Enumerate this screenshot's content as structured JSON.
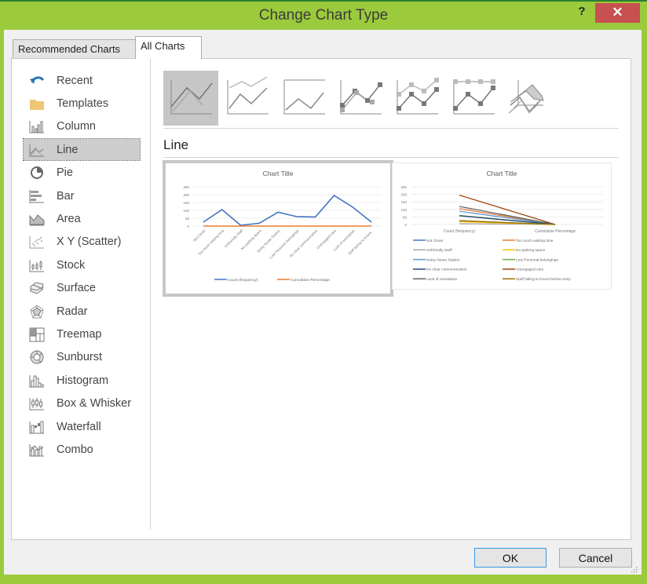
{
  "window": {
    "title": "Change Chart Type",
    "help_label": "?",
    "close_label": "✕"
  },
  "tabs": [
    {
      "label": "Recommended Charts",
      "active": false
    },
    {
      "label": "All Charts",
      "active": true
    }
  ],
  "sidebar": {
    "items": [
      {
        "label": "Recent",
        "icon": "recent-icon",
        "selected": false
      },
      {
        "label": "Templates",
        "icon": "folder-icon",
        "selected": false
      },
      {
        "label": "Column",
        "icon": "column-chart-icon",
        "selected": false
      },
      {
        "label": "Line",
        "icon": "line-chart-icon",
        "selected": true
      },
      {
        "label": "Pie",
        "icon": "pie-chart-icon",
        "selected": false
      },
      {
        "label": "Bar",
        "icon": "bar-chart-icon",
        "selected": false
      },
      {
        "label": "Area",
        "icon": "area-chart-icon",
        "selected": false
      },
      {
        "label": "X Y (Scatter)",
        "icon": "scatter-chart-icon",
        "selected": false
      },
      {
        "label": "Stock",
        "icon": "stock-chart-icon",
        "selected": false
      },
      {
        "label": "Surface",
        "icon": "surface-chart-icon",
        "selected": false
      },
      {
        "label": "Radar",
        "icon": "radar-chart-icon",
        "selected": false
      },
      {
        "label": "Treemap",
        "icon": "treemap-chart-icon",
        "selected": false
      },
      {
        "label": "Sunburst",
        "icon": "sunburst-chart-icon",
        "selected": false
      },
      {
        "label": "Histogram",
        "icon": "histogram-chart-icon",
        "selected": false
      },
      {
        "label": "Box & Whisker",
        "icon": "box-whisker-chart-icon",
        "selected": false
      },
      {
        "label": "Waterfall",
        "icon": "waterfall-chart-icon",
        "selected": false
      },
      {
        "label": "Combo",
        "icon": "combo-chart-icon",
        "selected": false
      }
    ]
  },
  "subtypes": [
    {
      "name": "line",
      "selected": true
    },
    {
      "name": "stacked-line",
      "selected": false
    },
    {
      "name": "100-stacked-line",
      "selected": false
    },
    {
      "name": "line-with-markers",
      "selected": false
    },
    {
      "name": "stacked-line-with-markers",
      "selected": false
    },
    {
      "name": "100-stacked-line-with-markers",
      "selected": false
    },
    {
      "name": "3d-line",
      "selected": false
    }
  ],
  "section_title": "Line",
  "colors": {
    "window_frame": "#9bca3c",
    "close_button": "#c75050",
    "ok_border": "#3c97e0",
    "selection": "#cdcdcd"
  },
  "chart_data": [
    {
      "type": "line",
      "title": "Chart Title",
      "categories": [
        "Not Clean",
        "Too much waiting time",
        "Unfriendly Staff",
        "No parking space",
        "Noisy Nurse Station",
        "Lost Personal belongings",
        "No clear communication",
        "Unengaged care",
        "Lack of orientation",
        "Staff failing to knock..."
      ],
      "series": [
        {
          "name": "Count (frequency)",
          "color": "#4472c4",
          "values": [
            25,
            105,
            5,
            18,
            88,
            60,
            58,
            195,
            120,
            25
          ]
        },
        {
          "name": "Cumulative Percentage",
          "color": "#ed7d31",
          "values": [
            0,
            0,
            0,
            0,
            0,
            0,
            0,
            0,
            0,
            0
          ]
        }
      ],
      "yticks": [
        "0",
        "50",
        "100",
        "150",
        "200",
        "250"
      ],
      "ylim": [
        0,
        250
      ],
      "grid": true,
      "legend": "bottom",
      "selected": true
    },
    {
      "type": "line",
      "title": "Chart Title",
      "categories": [
        "Count (frequency)",
        "Cumulative Percentage"
      ],
      "series": [
        {
          "name": "Not Clean",
          "color": "#4472c4",
          "values": [
            25,
            0
          ]
        },
        {
          "name": "Too much waiting time",
          "color": "#ed7d31",
          "values": [
            105,
            0
          ]
        },
        {
          "name": "Unfriendly Staff",
          "color": "#a5a5a5",
          "values": [
            5,
            0
          ]
        },
        {
          "name": "No parking space",
          "color": "#ffc000",
          "values": [
            18,
            0
          ]
        },
        {
          "name": "Noisy Nurse Station",
          "color": "#5b9bd5",
          "values": [
            88,
            0
          ]
        },
        {
          "name": "Lost Personal belongings",
          "color": "#70ad47",
          "values": [
            60,
            0
          ]
        },
        {
          "name": "No clear communication",
          "color": "#264478",
          "values": [
            58,
            0
          ]
        },
        {
          "name": "Unengaged care",
          "color": "#9e480e",
          "values": [
            195,
            0
          ]
        },
        {
          "name": "Lack of orientation",
          "color": "#636363",
          "values": [
            120,
            0
          ]
        },
        {
          "name": "Staff failing to knock before entry",
          "color": "#997300",
          "values": [
            25,
            0
          ]
        }
      ],
      "yticks": [
        "0",
        "50",
        "100",
        "150",
        "200",
        "250"
      ],
      "ylim": [
        0,
        250
      ],
      "grid": true,
      "legend": "bottom",
      "selected": false
    }
  ],
  "buttons": {
    "ok": "OK",
    "cancel": "Cancel"
  }
}
